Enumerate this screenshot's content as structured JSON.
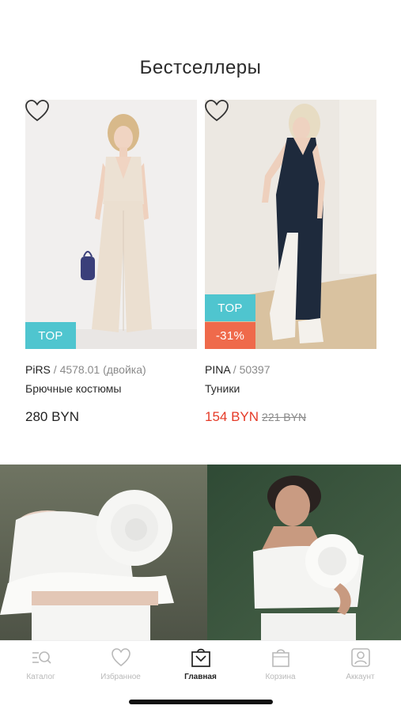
{
  "section": {
    "title": "Бестселлеры"
  },
  "products": [
    {
      "brand": "PiRS",
      "sku": " / 4578.01 (двойка)",
      "category": "Брючные костюмы",
      "price": "280 BYN",
      "old_price": "",
      "badges": [
        "TOP"
      ]
    },
    {
      "brand": "PINA",
      "sku": " / 50397",
      "category": "Туники",
      "price": "154 BYN",
      "old_price": "221 BYN",
      "badges": [
        "TOP",
        "-31%"
      ]
    }
  ],
  "tabbar": {
    "items": [
      {
        "label": "Каталог",
        "icon": "catalog-icon",
        "active": false
      },
      {
        "label": "Избранное",
        "icon": "heart-icon",
        "active": false
      },
      {
        "label": "Главная",
        "icon": "home-bag-icon",
        "active": true
      },
      {
        "label": "Корзина",
        "icon": "cart-bag-icon",
        "active": false
      },
      {
        "label": "Аккаунт",
        "icon": "account-icon",
        "active": false
      }
    ]
  },
  "colors": {
    "top_badge": "#4fc5cf",
    "sale_badge": "#ef6a4b",
    "sale_price": "#e53a27"
  }
}
